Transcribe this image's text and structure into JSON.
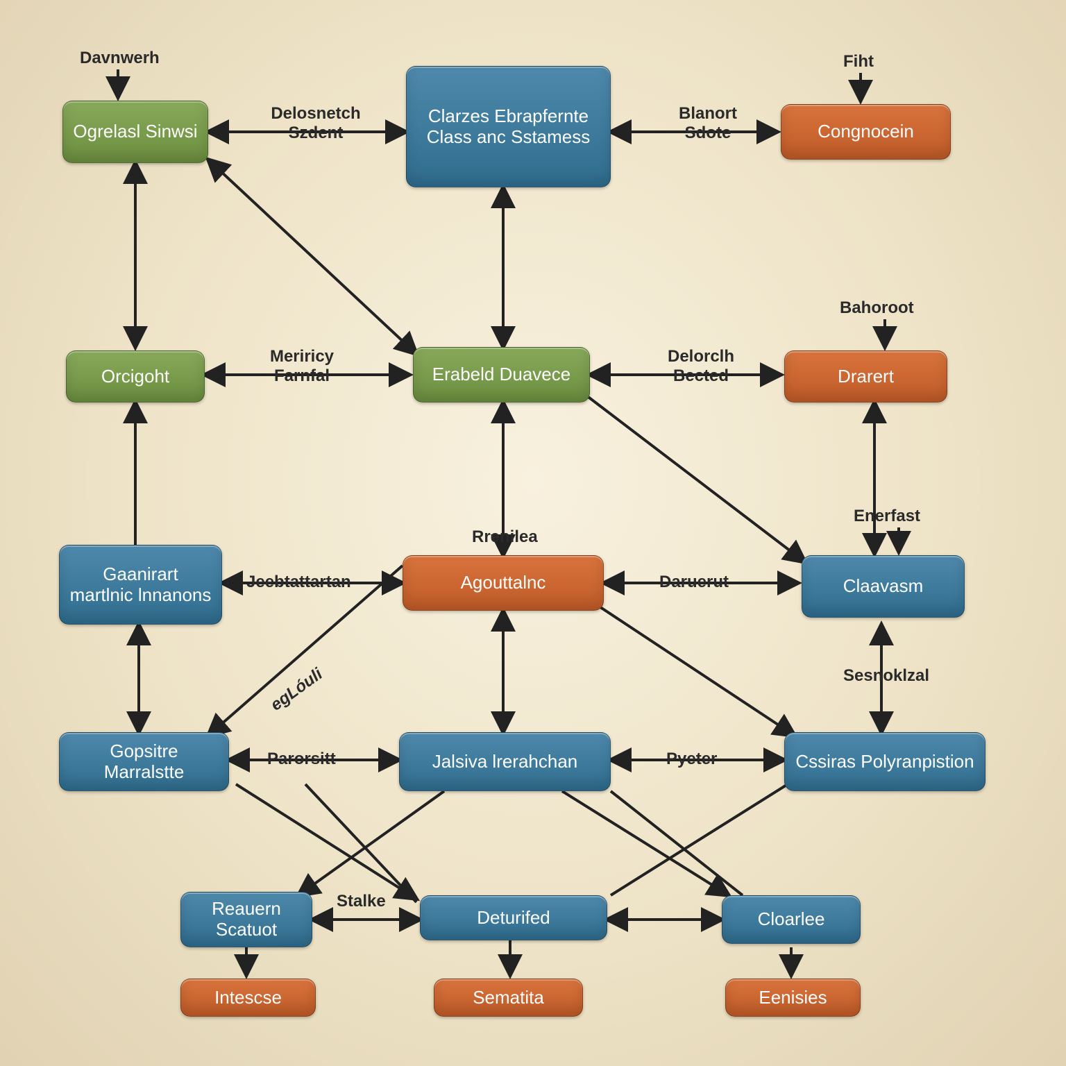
{
  "nodes": {
    "n1": {
      "text": "Ogrelasl Sinwsi"
    },
    "n2": {
      "text": "Clarzes Ebrapfernte Class anc Sstamess"
    },
    "n3": {
      "text": "Congnocein"
    },
    "n4": {
      "text": "Orcigoht"
    },
    "n5": {
      "text": "Erabeld Duavece"
    },
    "n6": {
      "text": "Drarert"
    },
    "n7": {
      "text": "Gaanirart martlnic lnnanons"
    },
    "n8": {
      "text": "Agouttalnc"
    },
    "n9": {
      "text": "Claavasm"
    },
    "n10": {
      "text": "Gopsitre Marralstte"
    },
    "n11": {
      "text": "Jalsiva lrerahchan"
    },
    "n12": {
      "text": "Cssiras Polyranpistion"
    },
    "n13": {
      "text": "Reauern Scatuot"
    },
    "n14": {
      "text": "Deturifed"
    },
    "n15": {
      "text": "Cloarlee"
    },
    "n16": {
      "text": "Intescse"
    },
    "n17": {
      "text": "Sematita"
    },
    "n18": {
      "text": "Eenisies"
    }
  },
  "labels": {
    "l_davnwerh": "Davnwerh",
    "l_delosench": "Delosnetch Szdent",
    "l_blanort": "Blanort Sdote",
    "l_fiht": "Fiht",
    "l_meriricy": "Meriricy Farnfal",
    "l_delorclh": "Delorclh Bected",
    "l_bahoroot": "Bahoroot",
    "l_rrenilea": "Rrenilea",
    "l_jeebtattan": "Jeebtattartan",
    "l_daruerut": "Daruerut",
    "l_enerfast": "Enerfast",
    "l_eglouli": "egLóuli",
    "l_parorsitt": "Parorsitt",
    "l_pyeter": "Pyeter",
    "l_sesnoklza": "Sesnoklzal",
    "l_stalke": "Stalke"
  }
}
